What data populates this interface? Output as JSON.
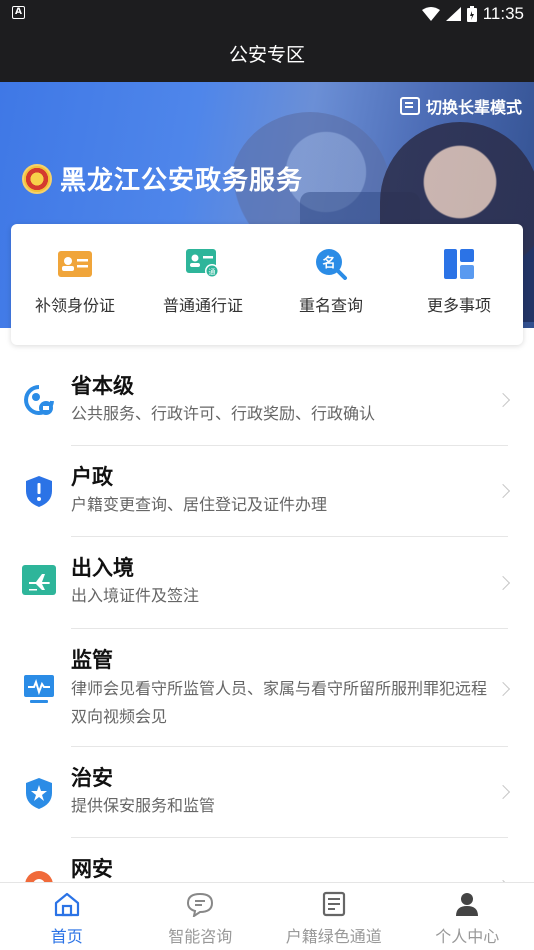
{
  "status_bar": {
    "time": "11:35",
    "left_icon": "A"
  },
  "header": {
    "title": "公安专区"
  },
  "hero": {
    "mode_switch_label": "切换长辈模式",
    "title": "黑龙江公安政务服务"
  },
  "quick_actions": [
    {
      "label": "补领身份证",
      "icon": "id-card-icon",
      "color": "#f0a53a"
    },
    {
      "label": "普通通行证",
      "icon": "permit-card-icon",
      "color": "#2eb59a"
    },
    {
      "label": "重名查询",
      "icon": "name-search-icon",
      "color": "#2b8ce6"
    },
    {
      "label": "更多事项",
      "icon": "grid-more-icon",
      "color": "#2b73e6"
    }
  ],
  "services": [
    {
      "title": "省本级",
      "desc": "公共服务、行政许可、行政奖励、行政确认",
      "icon": "province-service-icon"
    },
    {
      "title": "户政",
      "desc": "户籍变更查询、居住登记及证件办理",
      "icon": "household-shield-icon"
    },
    {
      "title": "出入境",
      "desc": "出入境证件及签注",
      "icon": "airplane-icon"
    },
    {
      "title": "监管",
      "desc": "律师会见看守所监管人员、家属与看守所留所服刑罪犯远程双向视频会见",
      "icon": "monitor-pulse-icon"
    },
    {
      "title": "治安",
      "desc": "提供保安服务和监管",
      "icon": "star-shield-icon"
    },
    {
      "title": "网安",
      "desc": "",
      "icon": "cyber-security-icon"
    }
  ],
  "bottom_nav": [
    {
      "label": "首页",
      "icon": "home-icon",
      "active": true
    },
    {
      "label": "智能咨询",
      "icon": "chat-icon",
      "active": false
    },
    {
      "label": "户籍绿色通道",
      "icon": "document-list-icon",
      "active": false
    },
    {
      "label": "个人中心",
      "icon": "person-icon",
      "active": false
    }
  ],
  "colors": {
    "accent": "#2b73e6",
    "status_bar_bg": "#1d1d1f"
  }
}
